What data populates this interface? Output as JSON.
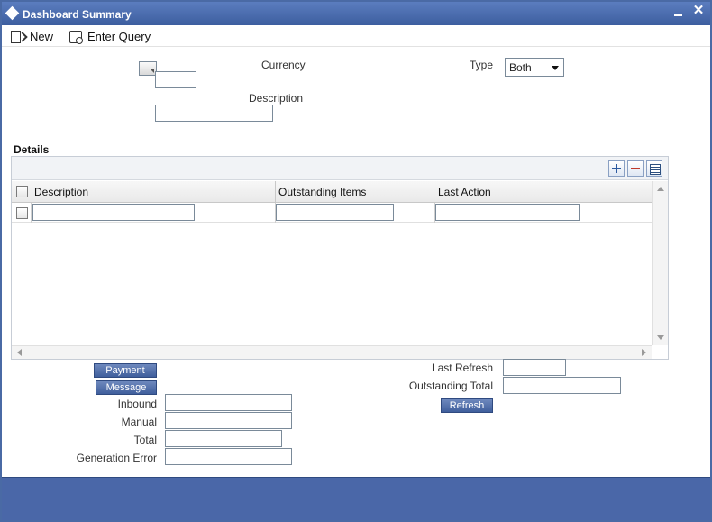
{
  "window": {
    "title": "Dashboard Summary"
  },
  "toolbar": {
    "new_label": "New",
    "enter_query_label": "Enter Query"
  },
  "form": {
    "currency_label": "Currency",
    "currency_value": "",
    "type_label": "Type",
    "type_value": "Both",
    "description_label": "Description",
    "description_value": ""
  },
  "details": {
    "title": "Details",
    "columns": [
      "Description",
      "Outstanding Items",
      "Last Action"
    ],
    "rows": [
      {
        "description": "",
        "outstanding_items": "",
        "last_action": ""
      }
    ]
  },
  "summary": {
    "payment_label": "Payment",
    "message_label": "Message",
    "inbound_label": "Inbound",
    "manual_label": "Manual",
    "total_label": "Total",
    "generation_error_label": "Generation Error",
    "last_refresh_label": "Last Refresh",
    "outstanding_total_label": "Outstanding Total",
    "refresh_label": "Refresh"
  },
  "colors": {
    "titlebar": "#4a6aa5",
    "button": "#4f6eaa",
    "footer": "#4a67a8"
  }
}
